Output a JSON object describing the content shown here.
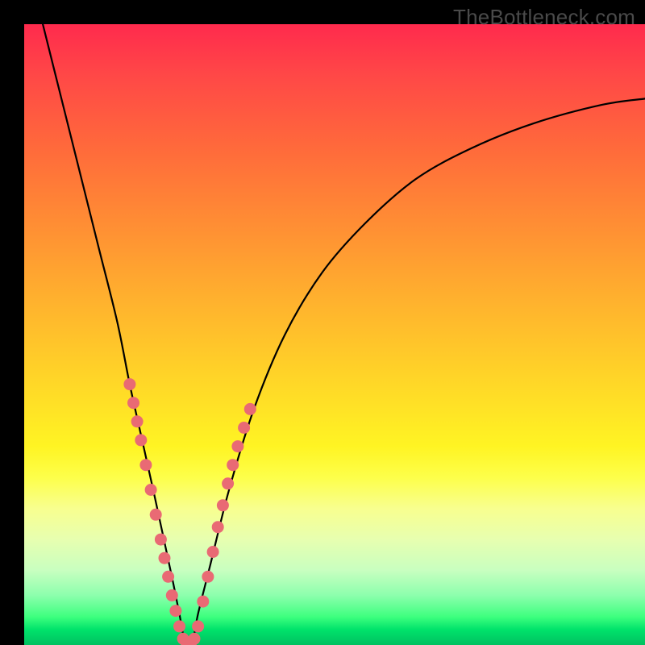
{
  "watermark": "TheBottleneck.com",
  "colors": {
    "marker": "#e96a74",
    "curve": "#000000",
    "frame": "#000000"
  },
  "chart_data": {
    "type": "line",
    "title": "",
    "xlabel": "",
    "ylabel": "",
    "xlim": [
      0,
      100
    ],
    "ylim": [
      0,
      100
    ],
    "series": [
      {
        "name": "bottleneck-curve",
        "x": [
          3,
          6,
          9,
          12,
          15,
          17,
          19,
          21,
          22.5,
          24,
          25,
          26,
          27,
          28,
          30,
          33,
          37,
          42,
          48,
          55,
          63,
          72,
          82,
          93,
          100
        ],
        "values": [
          100,
          88,
          76,
          64,
          52,
          42,
          33,
          24,
          17,
          10,
          5,
          0,
          0,
          5,
          13,
          25,
          38,
          50,
          60,
          68,
          75,
          80,
          84,
          87,
          88
        ]
      }
    ],
    "markers": [
      {
        "x": 17.0,
        "y": 42
      },
      {
        "x": 17.6,
        "y": 39
      },
      {
        "x": 18.2,
        "y": 36
      },
      {
        "x": 18.8,
        "y": 33
      },
      {
        "x": 19.6,
        "y": 29
      },
      {
        "x": 20.4,
        "y": 25
      },
      {
        "x": 21.2,
        "y": 21
      },
      {
        "x": 22.0,
        "y": 17
      },
      {
        "x": 22.6,
        "y": 14
      },
      {
        "x": 23.2,
        "y": 11
      },
      {
        "x": 23.8,
        "y": 8
      },
      {
        "x": 24.4,
        "y": 5.5
      },
      {
        "x": 25.0,
        "y": 3
      },
      {
        "x": 25.6,
        "y": 1
      },
      {
        "x": 26.2,
        "y": 0
      },
      {
        "x": 26.8,
        "y": 0
      },
      {
        "x": 27.4,
        "y": 1
      },
      {
        "x": 28.0,
        "y": 3
      },
      {
        "x": 28.8,
        "y": 7
      },
      {
        "x": 29.6,
        "y": 11
      },
      {
        "x": 30.4,
        "y": 15
      },
      {
        "x": 31.2,
        "y": 19
      },
      {
        "x": 32.0,
        "y": 22.5
      },
      {
        "x": 32.8,
        "y": 26
      },
      {
        "x": 33.6,
        "y": 29
      },
      {
        "x": 34.4,
        "y": 32
      },
      {
        "x": 35.4,
        "y": 35
      },
      {
        "x": 36.4,
        "y": 38
      }
    ]
  }
}
